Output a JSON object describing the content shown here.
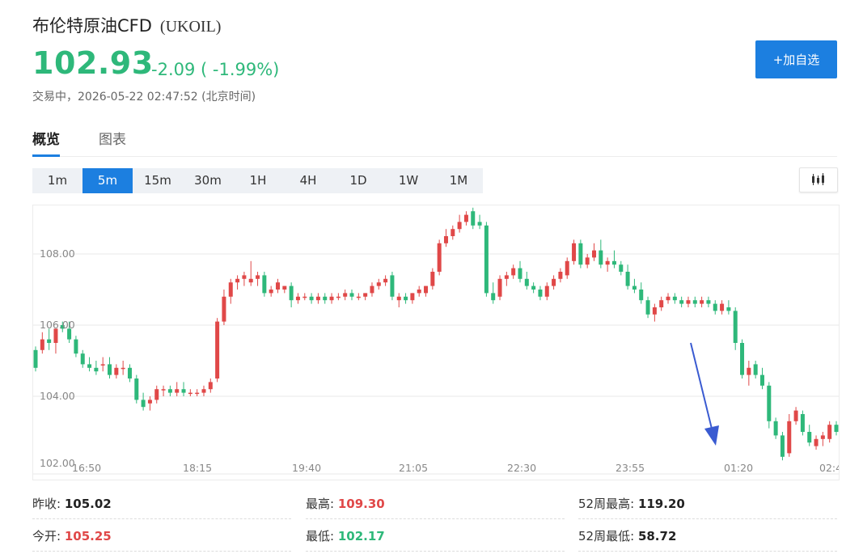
{
  "header": {
    "name": "布伦特原油CFD",
    "code": "(UKOIL)",
    "price": "102.93",
    "change": "-2.09 ( -1.99%)",
    "status": "交易中，2026-05-22 02:47:52 (北京时间)",
    "watch_button": "+加自选"
  },
  "tabs": [
    {
      "label": "概览",
      "active": true
    },
    {
      "label": "图表",
      "active": false
    }
  ],
  "intervals": [
    {
      "label": "1m",
      "active": false
    },
    {
      "label": "5m",
      "active": true
    },
    {
      "label": "15m",
      "active": false
    },
    {
      "label": "30m",
      "active": false
    },
    {
      "label": "1H",
      "active": false
    },
    {
      "label": "4H",
      "active": false
    },
    {
      "label": "1D",
      "active": false
    },
    {
      "label": "1W",
      "active": false
    },
    {
      "label": "1M",
      "active": false
    }
  ],
  "chart_type_icon": "candlestick-icon",
  "colors": {
    "up": "#e04848",
    "down": "#2eb87a",
    "accent": "#1c7fe0",
    "arrow": "#3a5bd1"
  },
  "chart_data": {
    "type": "candlestick",
    "ylim": [
      102.0,
      110.0
    ],
    "y_ticks": [
      "102.00",
      "104.00",
      "106.00",
      "108.00"
    ],
    "x_ticks": [
      "16:50",
      "18:15",
      "19:40",
      "21:05",
      "22:30",
      "23:55",
      "01:20",
      "02:4"
    ],
    "annotation": "down-arrow-icon",
    "ohlc": [
      [
        105.3,
        105.4,
        104.7,
        104.8
      ],
      [
        105.3,
        105.8,
        105.2,
        105.6
      ],
      [
        105.6,
        105.9,
        105.3,
        105.5
      ],
      [
        105.5,
        105.9,
        105.2,
        105.9
      ],
      [
        106.0,
        106.1,
        105.8,
        105.9
      ],
      [
        105.9,
        106.1,
        105.5,
        105.6
      ],
      [
        105.6,
        105.7,
        105.1,
        105.2
      ],
      [
        105.2,
        105.3,
        104.8,
        104.9
      ],
      [
        104.9,
        105.1,
        104.7,
        104.8
      ],
      [
        104.8,
        105.0,
        104.6,
        104.7
      ],
      [
        104.9,
        105.1,
        104.7,
        104.9
      ],
      [
        104.9,
        105.1,
        104.5,
        104.6
      ],
      [
        104.6,
        104.9,
        104.5,
        104.8
      ],
      [
        104.8,
        105.0,
        104.6,
        104.8
      ],
      [
        104.8,
        104.9,
        104.4,
        104.5
      ],
      [
        104.5,
        104.6,
        103.8,
        103.9
      ],
      [
        103.9,
        104.1,
        103.6,
        103.7
      ],
      [
        103.8,
        104.0,
        103.6,
        103.9
      ],
      [
        103.9,
        104.3,
        103.8,
        104.2
      ],
      [
        104.2,
        104.3,
        104.0,
        104.2
      ],
      [
        104.2,
        104.3,
        104.0,
        104.1
      ],
      [
        104.1,
        104.4,
        104.0,
        104.2
      ],
      [
        104.2,
        104.4,
        104.0,
        104.1
      ],
      [
        104.1,
        104.2,
        104.0,
        104.1
      ],
      [
        104.1,
        104.2,
        104.0,
        104.1
      ],
      [
        104.1,
        104.3,
        104.0,
        104.2
      ],
      [
        104.2,
        104.5,
        104.1,
        104.4
      ],
      [
        104.5,
        106.2,
        104.4,
        106.1
      ],
      [
        106.1,
        107.0,
        106.0,
        106.8
      ],
      [
        106.8,
        107.3,
        106.6,
        107.2
      ],
      [
        107.2,
        107.4,
        107.0,
        107.3
      ],
      [
        107.3,
        107.5,
        107.1,
        107.4
      ],
      [
        107.2,
        107.8,
        107.1,
        107.3
      ],
      [
        107.3,
        107.5,
        107.1,
        107.4
      ],
      [
        107.4,
        107.5,
        106.8,
        106.9
      ],
      [
        106.9,
        107.1,
        106.8,
        107.0
      ],
      [
        107.0,
        107.3,
        106.9,
        107.2
      ],
      [
        107.0,
        107.1,
        106.9,
        107.1
      ],
      [
        107.1,
        107.2,
        106.5,
        106.7
      ],
      [
        106.7,
        106.9,
        106.6,
        106.8
      ],
      [
        106.8,
        106.9,
        106.7,
        106.8
      ],
      [
        106.8,
        106.9,
        106.6,
        106.7
      ],
      [
        106.7,
        106.9,
        106.6,
        106.8
      ],
      [
        106.8,
        106.9,
        106.6,
        106.7
      ],
      [
        106.7,
        106.9,
        106.6,
        106.8
      ],
      [
        106.8,
        106.9,
        106.7,
        106.8
      ],
      [
        106.8,
        107.0,
        106.7,
        106.9
      ],
      [
        106.9,
        107.0,
        106.7,
        106.8
      ],
      [
        106.8,
        106.9,
        106.7,
        106.8
      ],
      [
        106.8,
        106.9,
        106.7,
        106.9
      ],
      [
        106.9,
        107.2,
        106.8,
        107.1
      ],
      [
        107.1,
        107.3,
        107.0,
        107.2
      ],
      [
        107.2,
        107.4,
        107.1,
        107.3
      ],
      [
        107.4,
        107.5,
        106.7,
        106.8
      ],
      [
        106.7,
        106.9,
        106.5,
        106.8
      ],
      [
        106.8,
        106.9,
        106.6,
        106.7
      ],
      [
        106.7,
        106.9,
        106.6,
        106.9
      ],
      [
        106.9,
        107.1,
        106.8,
        107.0
      ],
      [
        106.9,
        107.1,
        106.8,
        107.1
      ],
      [
        107.1,
        107.6,
        107.0,
        107.5
      ],
      [
        107.5,
        108.4,
        107.4,
        108.3
      ],
      [
        108.3,
        108.7,
        108.2,
        108.5
      ],
      [
        108.5,
        108.8,
        108.4,
        108.7
      ],
      [
        108.7,
        109.1,
        108.6,
        108.9
      ],
      [
        108.9,
        109.2,
        108.8,
        109.1
      ],
      [
        109.2,
        109.3,
        108.7,
        108.8
      ],
      [
        108.9,
        109.1,
        108.7,
        108.8
      ],
      [
        108.8,
        108.9,
        106.8,
        106.9
      ],
      [
        106.9,
        107.2,
        106.6,
        106.7
      ],
      [
        106.8,
        107.4,
        106.7,
        107.3
      ],
      [
        107.3,
        107.5,
        107.1,
        107.4
      ],
      [
        107.4,
        107.7,
        107.3,
        107.6
      ],
      [
        107.6,
        107.8,
        107.2,
        107.3
      ],
      [
        107.3,
        107.5,
        107.0,
        107.1
      ],
      [
        107.1,
        107.2,
        106.9,
        107.0
      ],
      [
        107.0,
        107.1,
        106.7,
        106.8
      ],
      [
        106.8,
        107.2,
        106.7,
        107.1
      ],
      [
        107.1,
        107.4,
        107.0,
        107.3
      ],
      [
        107.3,
        107.6,
        107.2,
        107.5
      ],
      [
        107.4,
        107.9,
        107.3,
        107.8
      ],
      [
        107.8,
        108.4,
        107.7,
        108.3
      ],
      [
        108.3,
        108.4,
        107.6,
        107.7
      ],
      [
        107.7,
        108.0,
        107.6,
        107.9
      ],
      [
        107.9,
        108.3,
        107.8,
        108.1
      ],
      [
        108.1,
        108.4,
        107.6,
        107.7
      ],
      [
        107.7,
        107.9,
        107.5,
        107.8
      ],
      [
        107.8,
        108.1,
        107.6,
        107.7
      ],
      [
        107.7,
        107.8,
        107.4,
        107.5
      ],
      [
        107.5,
        107.7,
        107.0,
        107.1
      ],
      [
        107.1,
        107.3,
        106.9,
        107.0
      ],
      [
        107.0,
        107.2,
        106.6,
        106.7
      ],
      [
        106.7,
        106.8,
        106.2,
        106.3
      ],
      [
        106.3,
        106.6,
        106.1,
        106.5
      ],
      [
        106.5,
        106.8,
        106.4,
        106.7
      ],
      [
        106.7,
        106.9,
        106.6,
        106.8
      ],
      [
        106.8,
        106.9,
        106.6,
        106.7
      ],
      [
        106.7,
        106.8,
        106.5,
        106.6
      ],
      [
        106.6,
        106.8,
        106.5,
        106.7
      ],
      [
        106.7,
        106.8,
        106.5,
        106.6
      ],
      [
        106.6,
        106.8,
        106.5,
        106.7
      ],
      [
        106.7,
        106.8,
        106.5,
        106.6
      ],
      [
        106.6,
        106.7,
        106.3,
        106.4
      ],
      [
        106.4,
        106.7,
        106.3,
        106.6
      ],
      [
        106.5,
        106.7,
        106.3,
        106.4
      ],
      [
        106.4,
        106.5,
        105.3,
        105.5
      ],
      [
        105.5,
        105.6,
        104.5,
        104.6
      ],
      [
        104.6,
        105.0,
        104.3,
        104.8
      ],
      [
        104.9,
        105.0,
        104.5,
        104.6
      ],
      [
        104.6,
        104.8,
        104.2,
        104.3
      ],
      [
        104.3,
        104.4,
        103.1,
        103.3
      ],
      [
        103.3,
        103.4,
        102.8,
        102.9
      ],
      [
        102.9,
        103.0,
        102.2,
        102.3
      ],
      [
        102.4,
        103.5,
        102.3,
        103.3
      ],
      [
        103.3,
        103.7,
        103.2,
        103.6
      ],
      [
        103.5,
        103.6,
        102.9,
        103.0
      ],
      [
        103.0,
        103.2,
        102.6,
        102.7
      ],
      [
        102.6,
        102.9,
        102.5,
        102.8
      ],
      [
        102.8,
        103.0,
        102.6,
        102.9
      ],
      [
        102.8,
        103.3,
        102.7,
        103.2
      ],
      [
        103.2,
        103.3,
        102.9,
        103.0
      ]
    ]
  },
  "stats": {
    "prev_close_label": "昨收:",
    "prev_close": "105.02",
    "open_label": "今开:",
    "open": "105.25",
    "high_label": "最高:",
    "high": "109.30",
    "low_label": "最低:",
    "low": "102.17",
    "high52_label": "52周最高:",
    "high52": "119.20",
    "low52_label": "52周最低:",
    "low52": "58.72"
  }
}
